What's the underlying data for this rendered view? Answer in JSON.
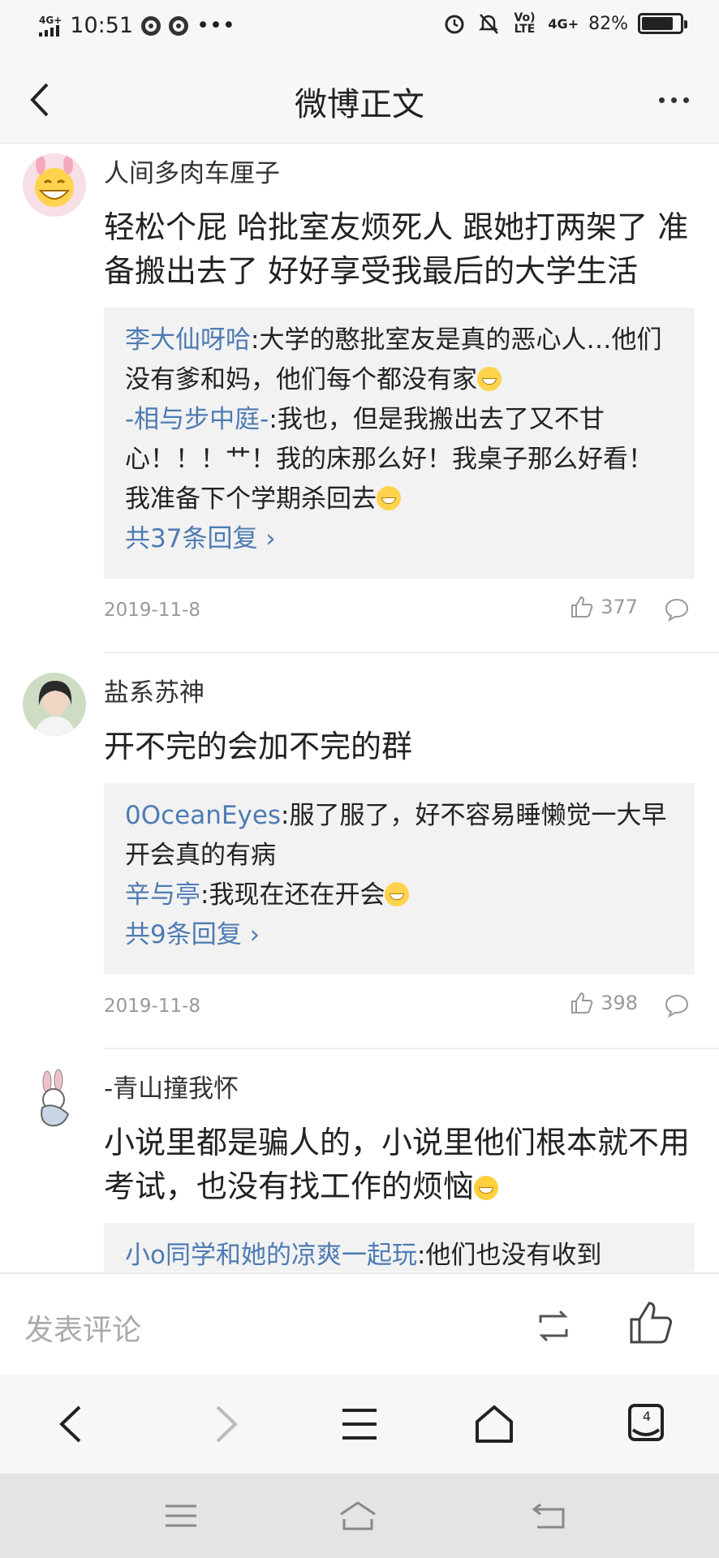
{
  "status_bar": {
    "network": "4G+",
    "time": "10:51",
    "dots": "•••",
    "volte": "Vo) LTE",
    "network_right": "4G+",
    "battery": "82%"
  },
  "header": {
    "title": "微博正文"
  },
  "comments": [
    {
      "name": "人间多肉车厘子",
      "text": "轻松个屁 哈批室友烦死人 跟她打两架了 准备搬出去了 好好享受我最后的大学生活",
      "replies": [
        {
          "name": "李大仙呀哈",
          "text": ":大学的憨批室友是真的恶心人…他们没有爹和妈，他们每个都没有家"
        },
        {
          "name": "-相与步中庭-",
          "text": ":我也，但是我搬出去了又不甘心！！！艹！我的床那么好！我桌子那么好看！我准备下个学期杀回去"
        }
      ],
      "more": "共37条回复 ›",
      "date": "2019-11-8",
      "likes": "377"
    },
    {
      "name": "盐系苏神",
      "text": "开不完的会加不完的群",
      "replies": [
        {
          "name": "0OceanEyes",
          "text": ":服了服了，好不容易睡懒觉一大早开会真的有病"
        },
        {
          "name": "辛与亭",
          "text": ":我现在还在开会"
        }
      ],
      "more": "共9条回复 ›",
      "date": "2019-11-8",
      "likes": "398"
    },
    {
      "name": "-青山撞我怀",
      "text": "小说里都是骗人的，小说里他们根本就不用考试，也没有找工作的烦恼",
      "replies": [
        {
          "name": "小o同学和她的凉爽一起玩",
          "text": ":他们也没有收到"
        }
      ]
    }
  ],
  "comment_bar": {
    "placeholder": "发表评论"
  },
  "browser_nav": {
    "tab_count": "4"
  }
}
